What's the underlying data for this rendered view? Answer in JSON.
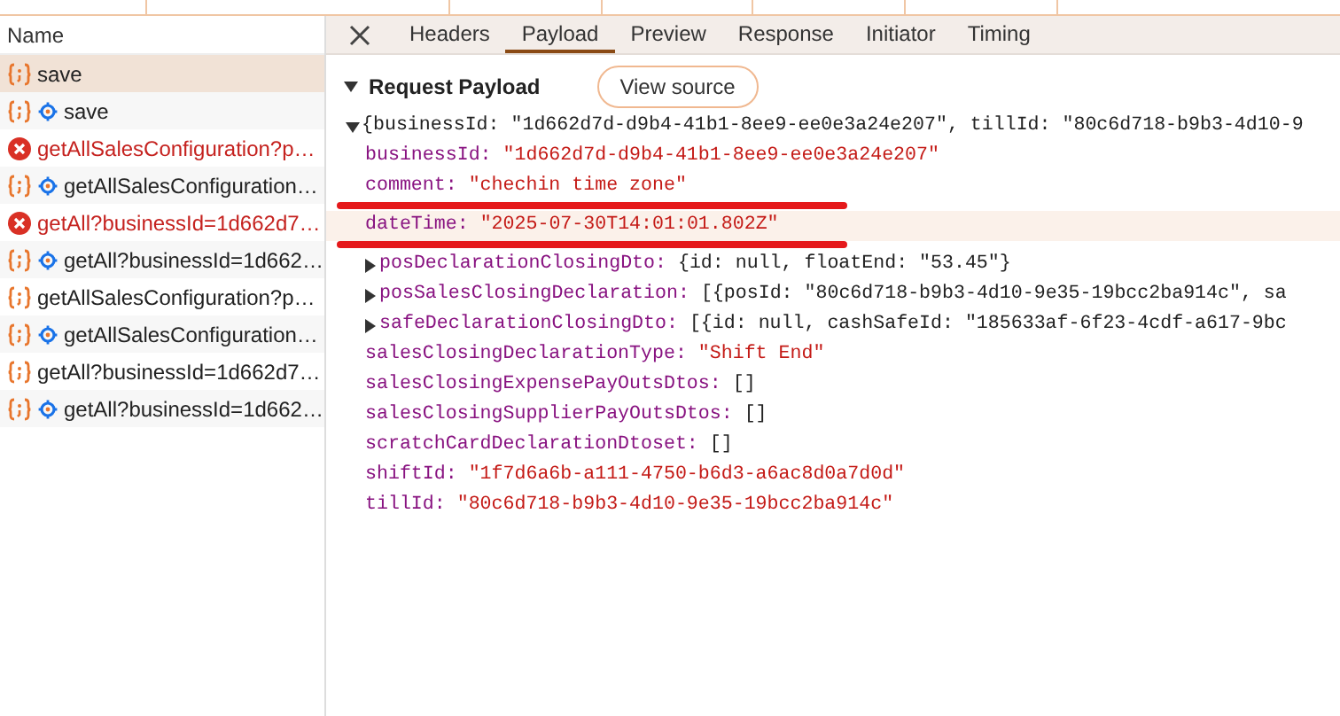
{
  "requests": {
    "column": "Name",
    "items": [
      {
        "label": "save",
        "kind": "json",
        "gear": false,
        "selected": true
      },
      {
        "label": "save",
        "kind": "json",
        "gear": true,
        "selected": false
      },
      {
        "label": "getAllSalesConfiguration?p…",
        "kind": "error",
        "gear": false,
        "selected": false
      },
      {
        "label": "getAllSalesConfiguration…",
        "kind": "json",
        "gear": true,
        "selected": false
      },
      {
        "label": "getAll?businessId=1d662d7…",
        "kind": "error",
        "gear": false,
        "selected": false
      },
      {
        "label": "getAll?businessId=1d662…",
        "kind": "json",
        "gear": true,
        "selected": false
      },
      {
        "label": "getAllSalesConfiguration?p…",
        "kind": "json",
        "gear": false,
        "selected": false
      },
      {
        "label": "getAllSalesConfiguration…",
        "kind": "json",
        "gear": true,
        "selected": false
      },
      {
        "label": "getAll?businessId=1d662d7…",
        "kind": "json",
        "gear": false,
        "selected": false
      },
      {
        "label": "getAll?businessId=1d662…",
        "kind": "json",
        "gear": true,
        "selected": false
      }
    ]
  },
  "tabs": [
    {
      "label": "Headers",
      "selected": false
    },
    {
      "label": "Payload",
      "selected": true
    },
    {
      "label": "Preview",
      "selected": false
    },
    {
      "label": "Response",
      "selected": false
    },
    {
      "label": "Initiator",
      "selected": false
    },
    {
      "label": "Timing",
      "selected": false
    }
  ],
  "payload": {
    "title": "Request Payload",
    "expanded": true,
    "view_source": "View source",
    "rows": [
      {
        "kind": "expanded",
        "key": "",
        "value": "{businessId: \"1d662d7d-d9b4-41b1-8ee9-ee0e3a24e207\", tillId: \"80c6d718-b9b3-4d10-9",
        "hovered": false,
        "underlined": false
      },
      {
        "kind": "string",
        "key": "businessId:",
        "value": "\"1d662d7d-d9b4-41b1-8ee9-ee0e3a24e207\"",
        "hovered": false,
        "underlined": false
      },
      {
        "kind": "string",
        "key": "comment:",
        "value": "\"chechin time zone\"",
        "hovered": false,
        "underlined": true
      },
      {
        "kind": "string",
        "key": "dateTime:",
        "value": "\"2025-07-30T14:01:01.802Z\"",
        "hovered": true,
        "underlined": true
      },
      {
        "kind": "collapsed",
        "key": "posDeclarationClosingDto:",
        "value": "{id: null, floatEnd: \"53.45\"}",
        "hovered": false,
        "underlined": false
      },
      {
        "kind": "collapsed",
        "key": "posSalesClosingDeclaration:",
        "value": "[{posId: \"80c6d718-b9b3-4d10-9e35-19bcc2ba914c\", sa",
        "hovered": false,
        "underlined": false
      },
      {
        "kind": "collapsed",
        "key": "safeDeclarationClosingDto:",
        "value": "[{id: null, cashSafeId: \"185633af-6f23-4cdf-a617-9bc",
        "hovered": false,
        "underlined": false
      },
      {
        "kind": "string",
        "key": "salesClosingDeclarationType:",
        "value": "\"Shift End\"",
        "hovered": false,
        "underlined": false
      },
      {
        "kind": "plain",
        "key": "salesClosingExpensePayOutsDtos:",
        "value": "[]",
        "hovered": false,
        "underlined": false
      },
      {
        "kind": "plain",
        "key": "salesClosingSupplierPayOutsDtos:",
        "value": "[]",
        "hovered": false,
        "underlined": false
      },
      {
        "kind": "plain",
        "key": "scratchCardDeclarationDtoset:",
        "value": "[]",
        "hovered": false,
        "underlined": false
      },
      {
        "kind": "string",
        "key": "shiftId:",
        "value": "\"1f7d6a6b-a111-4750-b6d3-a6ac8d0a7d0d\"",
        "hovered": false,
        "underlined": false
      },
      {
        "kind": "string",
        "key": "tillId:",
        "value": "\"80c6d718-b9b3-4d10-9e35-19bcc2ba914c\"",
        "hovered": false,
        "underlined": false
      }
    ]
  }
}
